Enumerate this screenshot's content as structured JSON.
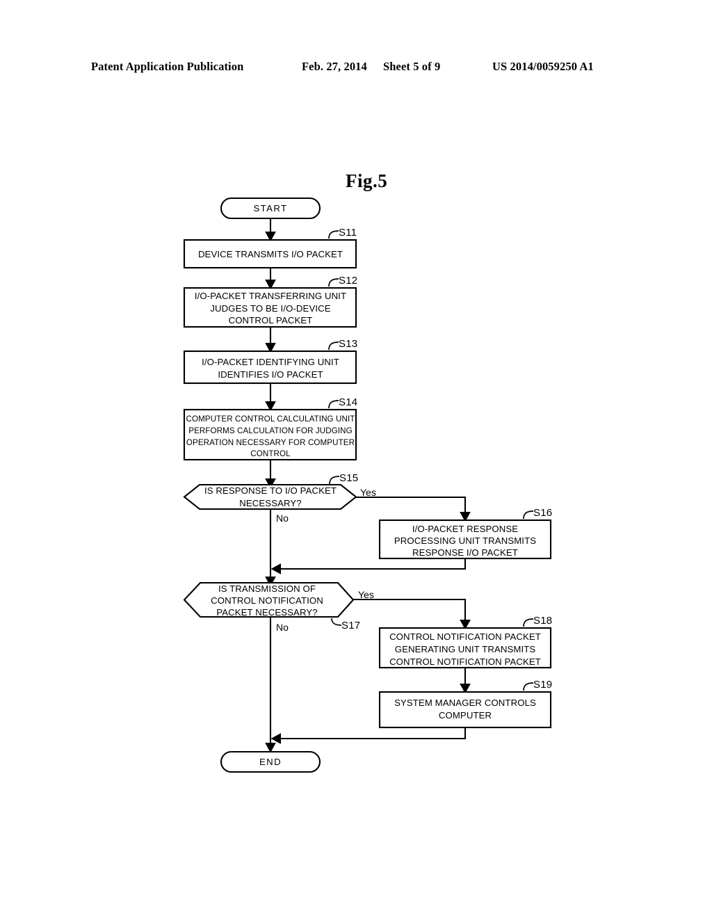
{
  "header": {
    "publication": "Patent Application Publication",
    "date": "Feb. 27, 2014",
    "sheet": "Sheet 5 of 9",
    "patent_number": "US 2014/0059250 A1"
  },
  "figure": {
    "title": "Fig.5"
  },
  "flowchart": {
    "start": {
      "id": "start",
      "label": "START"
    },
    "end": {
      "id": "end",
      "label": "END"
    },
    "branch_labels": {
      "yes": "Yes",
      "no": "No"
    },
    "steps": [
      {
        "id": "S11",
        "shape": "process",
        "lines": [
          "DEVICE TRANSMITS I/O PACKET"
        ]
      },
      {
        "id": "S12",
        "shape": "process",
        "lines": [
          "I/O-PACKET TRANSFERRING UNIT",
          "JUDGES TO BE I/O-DEVICE",
          "CONTROL PACKET"
        ]
      },
      {
        "id": "S13",
        "shape": "process",
        "lines": [
          "I/O-PACKET IDENTIFYING UNIT",
          "IDENTIFIES I/O PACKET"
        ]
      },
      {
        "id": "S14",
        "shape": "process",
        "lines": [
          "COMPUTER CONTROL CALCULATING UNIT",
          "PERFORMS CALCULATION FOR JUDGING",
          "OPERATION NECESSARY FOR COMPUTER",
          "CONTROL"
        ]
      },
      {
        "id": "S15",
        "shape": "decision",
        "lines": [
          "IS RESPONSE TO I/O PACKET",
          "NECESSARY?"
        ]
      },
      {
        "id": "S16",
        "shape": "process",
        "lines": [
          "I/O-PACKET RESPONSE",
          "PROCESSING UNIT TRANSMITS",
          "RESPONSE I/O PACKET"
        ]
      },
      {
        "id": "S17",
        "shape": "decision",
        "lines": [
          "IS TRANSMISSION OF",
          "CONTROL NOTIFICATION",
          "PACKET NECESSARY?"
        ]
      },
      {
        "id": "S18",
        "shape": "process",
        "lines": [
          "CONTROL NOTIFICATION PACKET",
          "GENERATING UNIT TRANSMITS",
          "CONTROL NOTIFICATION PACKET"
        ]
      },
      {
        "id": "S19",
        "shape": "process",
        "lines": [
          "SYSTEM MANAGER CONTROLS",
          "COMPUTER"
        ]
      }
    ]
  }
}
